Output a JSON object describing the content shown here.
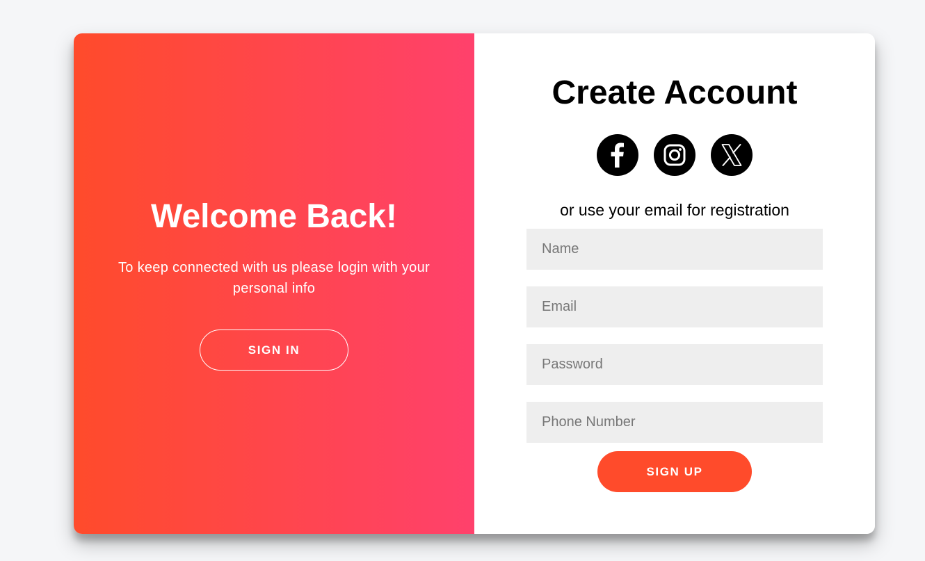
{
  "overlay": {
    "title": "Welcome Back!",
    "message": "To keep connected with us please login with your personal info",
    "sign_in_label": "SIGN IN"
  },
  "signup": {
    "title": "Create Account",
    "socials": [
      {
        "icon": "facebook-icon"
      },
      {
        "icon": "instagram-icon"
      },
      {
        "icon": "x-twitter-icon"
      }
    ],
    "subtitle": "or use your email for registration",
    "fields": {
      "name": {
        "placeholder": "Name",
        "value": ""
      },
      "email": {
        "placeholder": "Email",
        "value": ""
      },
      "password": {
        "placeholder": "Password",
        "value": ""
      },
      "phone": {
        "placeholder": "Phone Number",
        "value": ""
      }
    },
    "sign_up_label": "SIGN UP"
  },
  "colors": {
    "gradient_start": "#ff4b2b",
    "gradient_end": "#ff416c",
    "accent": "#ff4b2b",
    "input_bg": "#eeeeee",
    "page_bg": "#f5f6f8"
  }
}
